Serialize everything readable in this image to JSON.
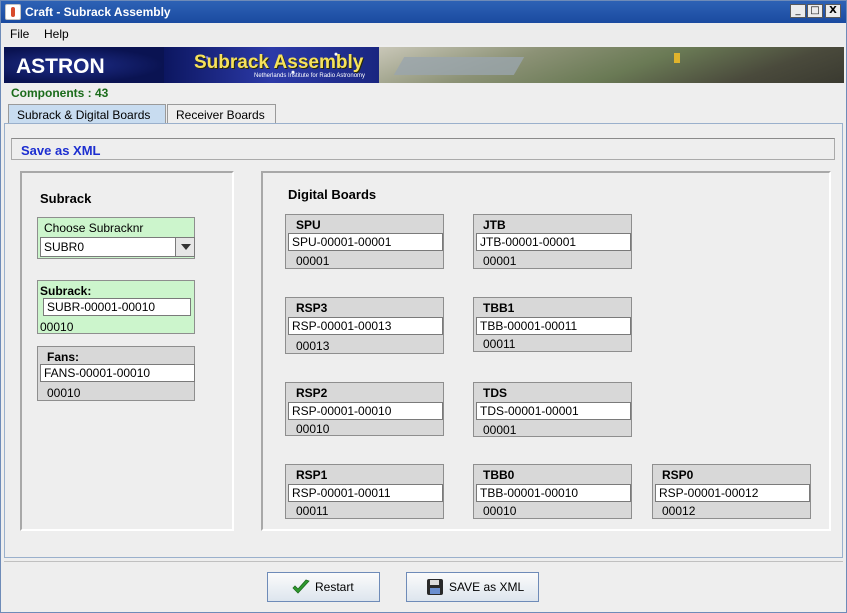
{
  "window": {
    "title": "Craft - Subrack Assembly",
    "controls": {
      "minimize": "_",
      "maximize": "□",
      "close": "X"
    }
  },
  "menu": {
    "items": [
      "File",
      "Help"
    ]
  },
  "banner": {
    "logo": "ASTRON",
    "title": "Subrack Assembly",
    "subtitle": "Netherlands Institute for Radio Astronomy"
  },
  "components_label": "Components : 43",
  "tabs": [
    {
      "label": "Subrack & Digital Boards",
      "active": true
    },
    {
      "label": "Receiver Boards",
      "active": false
    }
  ],
  "message": "Save as XML",
  "subrack": {
    "title": "Subrack",
    "chooser": {
      "label": "Choose Subracknr",
      "value": "SUBR0"
    },
    "subrack_box": {
      "label": "Subrack:",
      "value": "SUBR-00001-00010",
      "number": "00010"
    },
    "fans_box": {
      "label": "Fans:",
      "value": "FANS-00001-00010",
      "number": "00010"
    }
  },
  "digital": {
    "title": "Digital Boards",
    "boards": [
      {
        "label": "SPU",
        "value": "SPU-00001-00001",
        "number": "00001"
      },
      {
        "label": "JTB",
        "value": "JTB-00001-00001",
        "number": "00001"
      },
      {
        "label": "RSP3",
        "value": "RSP-00001-00013",
        "number": "00013"
      },
      {
        "label": "TBB1",
        "value": "TBB-00001-00011",
        "number": "00011"
      },
      {
        "label": "RSP2",
        "value": "RSP-00001-00010",
        "number": "00010"
      },
      {
        "label": "TDS",
        "value": "TDS-00001-00001",
        "number": "00001"
      },
      {
        "label": "RSP1",
        "value": "RSP-00001-00011",
        "number": "00011"
      },
      {
        "label": "TBB0",
        "value": "TBB-00001-00010",
        "number": "00010"
      },
      {
        "label": "RSP0",
        "value": "RSP-00001-00012",
        "number": "00012"
      }
    ]
  },
  "buttons": {
    "restart": "Restart",
    "save_xml": "SAVE as XML"
  }
}
